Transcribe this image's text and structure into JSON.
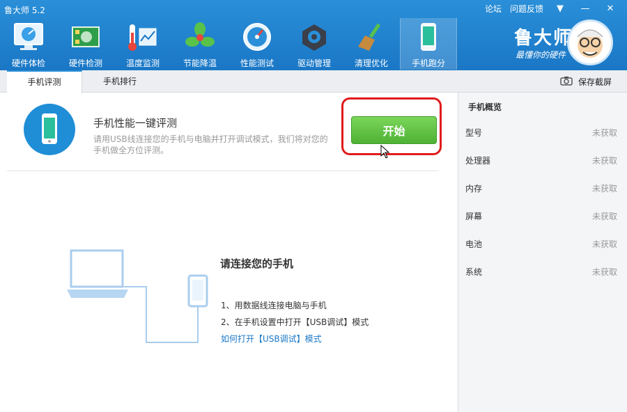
{
  "app": {
    "title": "鲁大师 5.2"
  },
  "top_links": {
    "forum": "论坛",
    "feedback": "问题反馈"
  },
  "tools": [
    {
      "label": "硬件体检",
      "icon": "monitor-gauge-icon"
    },
    {
      "label": "硬件检测",
      "icon": "circuit-board-icon"
    },
    {
      "label": "温度监测",
      "icon": "thermometer-chart-icon"
    },
    {
      "label": "节能降温",
      "icon": "fan-icon"
    },
    {
      "label": "性能测试",
      "icon": "speedometer-icon"
    },
    {
      "label": "驱动管理",
      "icon": "gear-box-icon"
    },
    {
      "label": "清理优化",
      "icon": "broom-icon"
    },
    {
      "label": "手机跑分",
      "icon": "phone-icon"
    }
  ],
  "brand": {
    "name": "鲁大师",
    "slogan": "最懂你的硬件"
  },
  "tabs": [
    {
      "label": "手机评测"
    },
    {
      "label": "手机排行"
    }
  ],
  "save_screenshot": "保存截屏",
  "hero": {
    "title": "手机性能一键评测",
    "description": "请用USB线连接您的手机与电脑并打开调试模式，我们将对您的手机做全方位评测。",
    "start_button": "开始"
  },
  "guide": {
    "title": "请连接您的手机",
    "steps": [
      "1、用数据线连接电脑与手机",
      "2、在手机设置中打开【USB调试】模式"
    ],
    "help_link": "如何打开【USB调试】模式"
  },
  "overview": {
    "title": "手机概览",
    "rows": [
      {
        "key": "型号",
        "value": "未获取"
      },
      {
        "key": "处理器",
        "value": "未获取"
      },
      {
        "key": "内存",
        "value": "未获取"
      },
      {
        "key": "屏幕",
        "value": "未获取"
      },
      {
        "key": "电池",
        "value": "未获取"
      },
      {
        "key": "系统",
        "value": "未获取"
      }
    ]
  },
  "colors": {
    "titlebar": "#1a77c6",
    "accent": "#2a8fd8",
    "start_green": "#4eb235",
    "highlight_red": "#e01b1b"
  }
}
